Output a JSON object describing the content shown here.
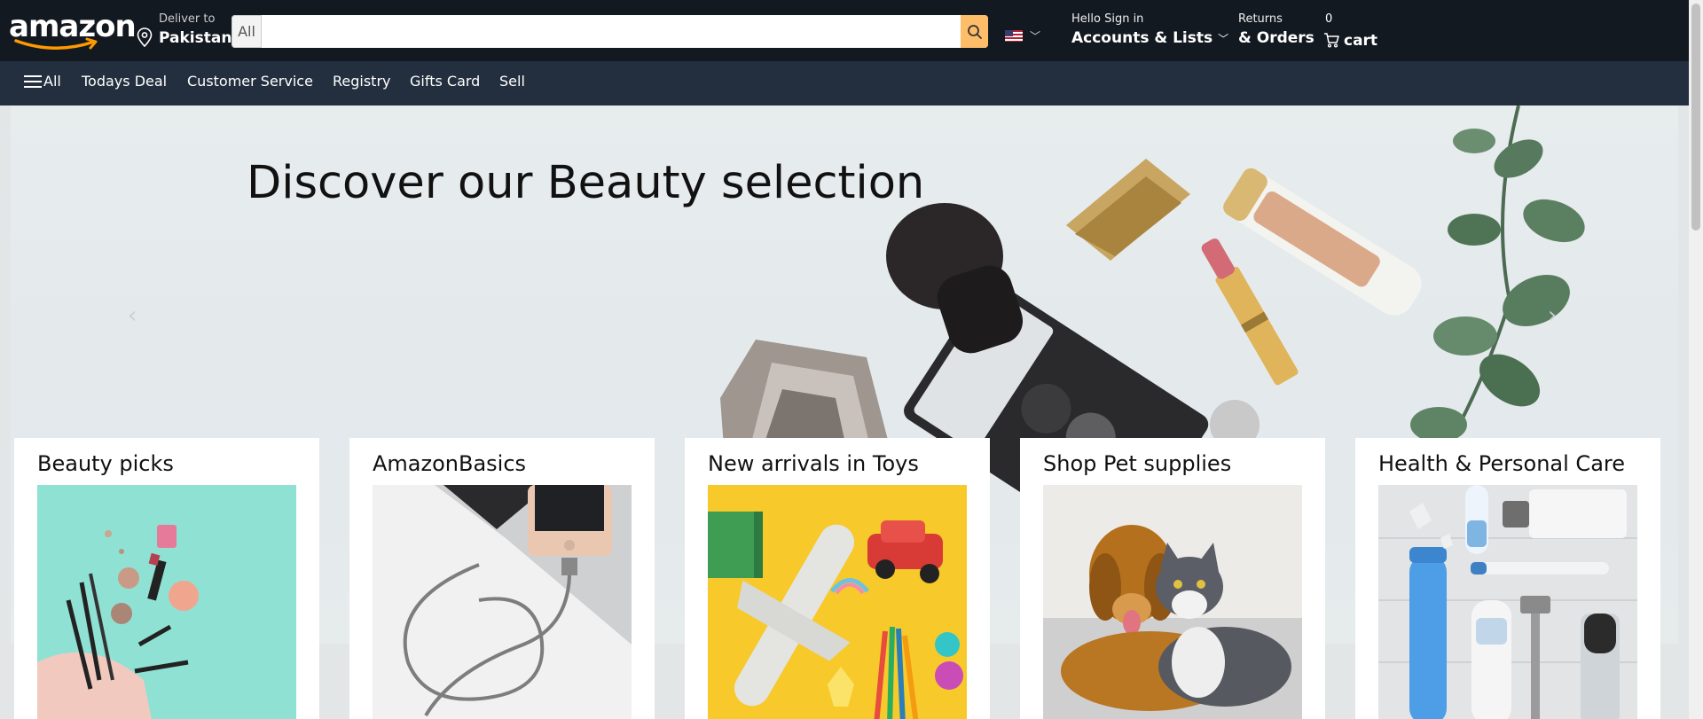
{
  "header": {
    "logo_text": "amazon",
    "deliver_line1": "Deliver to",
    "deliver_line2": "Pakistan",
    "search_category": "All",
    "search_placeholder": "",
    "account_line1": "Hello Sign in",
    "account_line2": "Accounts & Lists",
    "returns_line1": "Returns",
    "returns_line2": "& Orders",
    "cart_count": "0",
    "cart_label": "cart",
    "accent": "#febd69"
  },
  "subnav": {
    "all_label": "All",
    "items": [
      "Todays Deal",
      "Customer Service",
      "Registry",
      "Gifts Card",
      "Sell"
    ]
  },
  "hero": {
    "title": "Discover our Beauty selection",
    "prev_arrow": "‹",
    "next_arrow": "›"
  },
  "cards": [
    {
      "title": "Beauty picks"
    },
    {
      "title": "AmazonBasics"
    },
    {
      "title": "New arrivals in Toys"
    },
    {
      "title": "Shop Pet supplies"
    },
    {
      "title": "Health & Personal Care"
    }
  ]
}
